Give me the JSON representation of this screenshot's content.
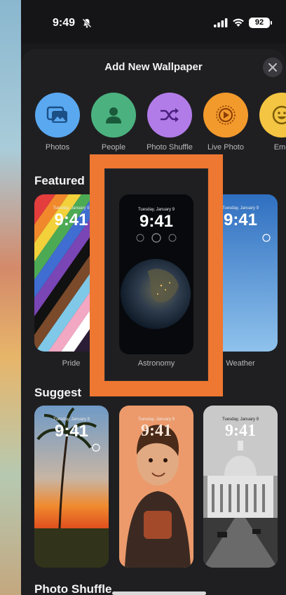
{
  "status_bar": {
    "time": "9:49",
    "battery": "92"
  },
  "sheet": {
    "title": "Add New Wallpaper"
  },
  "categories": [
    {
      "label": "Photos",
      "icon": "photos-icon",
      "color": "#5aa8f0"
    },
    {
      "label": "People",
      "icon": "person-icon",
      "color": "#4bb27f"
    },
    {
      "label": "Photo Shuffle",
      "icon": "shuffle-icon",
      "color": "#b27ce8"
    },
    {
      "label": "Live Photo",
      "icon": "live-photo-icon",
      "color": "#f39a2c"
    },
    {
      "label": "Emo",
      "icon": "emoji-icon",
      "color": "#f4c542"
    }
  ],
  "sections": {
    "featured": "Featured",
    "suggested": "Suggest",
    "photo_shuffle": "Photo Shuffle"
  },
  "featured": [
    {
      "label": "Pride",
      "date": "Tuesday, January 9",
      "time": "9:41"
    },
    {
      "label": "Astronomy",
      "date": "Tuesday, January 9",
      "time": "9:41"
    },
    {
      "label": "Weather",
      "date": "Tuesday, January 9",
      "time": "9:41"
    }
  ],
  "suggested": [
    {
      "date": "Tuesday, January 9",
      "time": "9:41"
    },
    {
      "date": "Tuesday, January 9",
      "time": "9:41"
    },
    {
      "date": "Tuesday, January 9",
      "time": "9:41"
    }
  ]
}
